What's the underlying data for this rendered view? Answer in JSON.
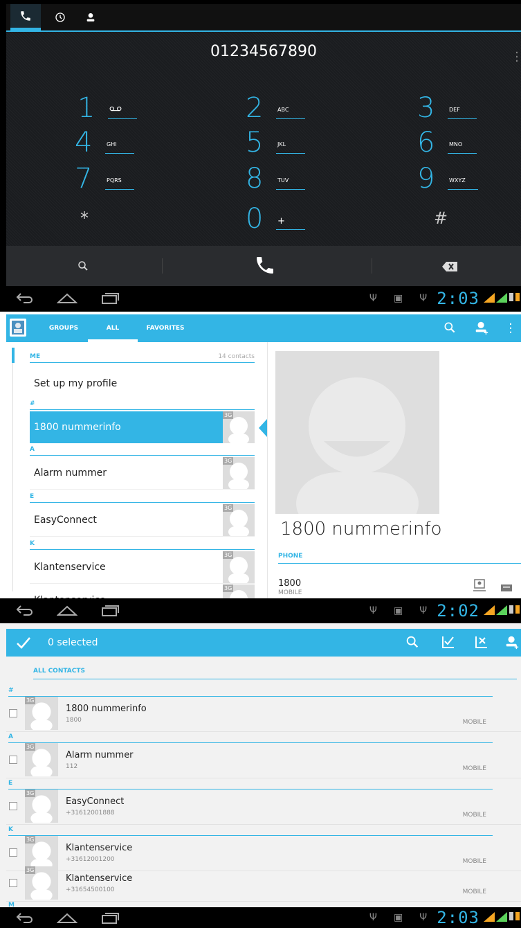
{
  "dialer": {
    "number": "01234567890",
    "keys": [
      {
        "digit": "1",
        "letters": ""
      },
      {
        "digit": "2",
        "letters": "ABC"
      },
      {
        "digit": "3",
        "letters": "DEF"
      },
      {
        "digit": "4",
        "letters": "GHI"
      },
      {
        "digit": "5",
        "letters": "JKL"
      },
      {
        "digit": "6",
        "letters": "MNO"
      },
      {
        "digit": "7",
        "letters": "PQRS"
      },
      {
        "digit": "8",
        "letters": "TUV"
      },
      {
        "digit": "9",
        "letters": "WXYZ"
      },
      {
        "digit": "*",
        "letters": ""
      },
      {
        "digit": "0",
        "letters": "+"
      },
      {
        "digit": "#",
        "letters": ""
      }
    ]
  },
  "clocks": [
    "2:03",
    "2:02",
    "2:03"
  ],
  "contacts": {
    "tabs": [
      "GROUPS",
      "ALL",
      "FAVORITES"
    ],
    "me_header": "ME",
    "contact_count": "14 contacts",
    "setup_profile": "Set up my profile",
    "sections": [
      "#",
      "A",
      "E",
      "K"
    ],
    "items": [
      "1800 nummerinfo",
      "Alarm nummer",
      "EasyConnect",
      "Klantenservice",
      "Klantenservice"
    ],
    "badge": "3G",
    "detail": {
      "name": "1800 nummerinfo",
      "phone_header": "PHONE",
      "phone": "1800",
      "phone_type": "MOBILE"
    }
  },
  "multiselect": {
    "selected_label": "0 selected",
    "all_header": "ALL CONTACTS",
    "letters": [
      "#",
      "A",
      "E",
      "K",
      "M"
    ],
    "rows": [
      {
        "name": "1800 nummerinfo",
        "number": "1800",
        "type": "MOBILE"
      },
      {
        "name": "Alarm nummer",
        "number": "112",
        "type": "MOBILE"
      },
      {
        "name": "EasyConnect",
        "number": "+31612001888",
        "type": "MOBILE"
      },
      {
        "name": "Klantenservice",
        "number": "+31612001200",
        "type": "MOBILE"
      },
      {
        "name": "Klantenservice",
        "number": "+31654500100",
        "type": "MOBILE"
      }
    ]
  },
  "colors": {
    "accent": "#33b5e5",
    "dialer_bg": "#1a1c1f",
    "signal": "#f5a623"
  }
}
